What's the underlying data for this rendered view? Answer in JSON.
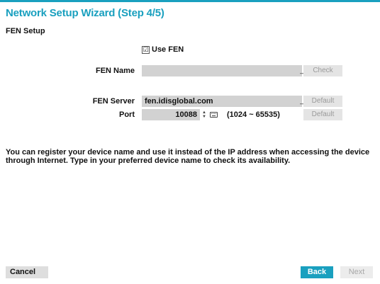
{
  "wizard": {
    "title": "Network Setup Wizard (Step 4/5)",
    "section_title": "FEN Setup",
    "use_fen": {
      "label": "Use FEN",
      "checked": true,
      "check_glyph": "☑"
    },
    "fen_name": {
      "label": "FEN Name",
      "value": "",
      "keyboard_glyph": "_",
      "check_button": "Check"
    },
    "fen_server": {
      "label": "FEN Server",
      "value": "fen.idisglobal.com",
      "keyboard_glyph": "_",
      "default_button": "Default"
    },
    "port": {
      "label": "Port",
      "value": "10088",
      "range": "(1024 ~ 65535)",
      "default_button": "Default"
    },
    "description": "You can register your device name and use it instead of the IP address when accessing the device through Internet. Type in your preferred device name to check its availability.",
    "buttons": {
      "cancel": "Cancel",
      "back": "Back",
      "next": "Next"
    },
    "colors": {
      "accent": "#1aa0bf",
      "field_bg": "#d2d2d2",
      "disabled_text": "#9a9a9a"
    },
    "icons": [
      "checkbox-icon",
      "keyboard-icon",
      "stepper-up-icon",
      "stepper-down-icon"
    ]
  }
}
